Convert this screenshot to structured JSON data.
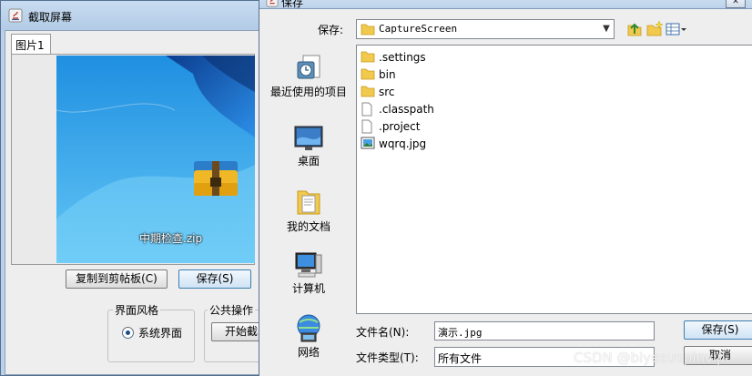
{
  "background_window": {
    "title": "截取屏幕",
    "tab_label": "图片1",
    "desktop_file_label": "中期检查.zip",
    "copy_button": "复制到剪帖板(C)",
    "save_button": "保存(S)",
    "style_group_label": "界面风格",
    "radio_label": "系统界面",
    "common_group_label": "公共操作",
    "start_button": "开始截"
  },
  "save_dialog": {
    "title": "保存",
    "close_glyph": "✕",
    "save_in_label": "保存:",
    "location": "CaptureScreen",
    "places": [
      {
        "label": "最近使用的项目",
        "icon": "recent-items-icon"
      },
      {
        "label": "桌面",
        "icon": "desktop-icon"
      },
      {
        "label": "我的文档",
        "icon": "documents-icon"
      },
      {
        "label": "计算机",
        "icon": "computer-icon"
      },
      {
        "label": "网络",
        "icon": "network-icon"
      }
    ],
    "files": [
      {
        "name": ".settings",
        "type": "folder"
      },
      {
        "name": "bin",
        "type": "folder"
      },
      {
        "name": "src",
        "type": "folder"
      },
      {
        "name": ".classpath",
        "type": "file"
      },
      {
        "name": ".project",
        "type": "file"
      },
      {
        "name": "wqrq.jpg",
        "type": "image"
      }
    ],
    "file_name_label": "文件名(N):",
    "file_name_value": "演示.jpg",
    "file_type_label": "文件类型(T):",
    "file_type_value": "所有文件",
    "save_button": "保存(S)",
    "cancel_button": "取消"
  },
  "watermark": "CSDN @biyezuopinvip"
}
